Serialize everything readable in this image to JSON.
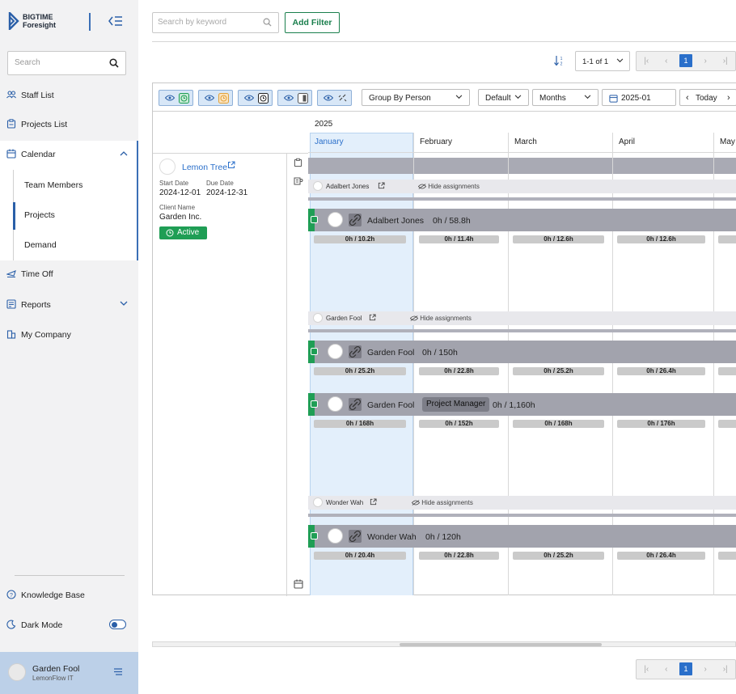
{
  "brand": {
    "line1": "BIGTIME",
    "line2": "Foresight"
  },
  "sidebar": {
    "search_placeholder": "Search",
    "items": [
      {
        "label": "Staff List",
        "icon": "users-icon"
      },
      {
        "label": "Projects List",
        "icon": "clipboard-icon"
      },
      {
        "label": "Calendar",
        "icon": "calendar-icon"
      },
      {
        "label": "Time Off",
        "icon": "airplane-icon"
      },
      {
        "label": "Reports",
        "icon": "report-icon"
      },
      {
        "label": "My Company",
        "icon": "building-icon"
      }
    ],
    "calendar_sub": [
      "Team Members",
      "Projects",
      "Demand"
    ],
    "knowledge_base": "Knowledge Base",
    "dark_mode": "Dark Mode",
    "user": {
      "name": "Garden Fool",
      "company": "LemonFlow IT"
    }
  },
  "toolbar": {
    "search_placeholder": "Search by keyword",
    "add_filter": "Add Filter",
    "page_range": "1-1 of 1",
    "current_page": "1"
  },
  "calendar": {
    "group_by": "Group By Person",
    "sort": "Default",
    "scale": "Months",
    "date": "2025-01",
    "today": "Today",
    "year": "2025",
    "months": [
      "January",
      "February",
      "March",
      "April",
      "May"
    ],
    "hide_label": "Hide assignments"
  },
  "project": {
    "name": "Lemon Tree",
    "start_label": "Start Date",
    "start": "2024-12-01",
    "due_label": "Due Date",
    "due": "2024-12-31",
    "client_label": "Client Name",
    "client": "Garden Inc.",
    "status": "Active"
  },
  "people": [
    {
      "name": "Adalbert Jones"
    },
    {
      "name": "Garden Fool"
    },
    {
      "name": "Wonder Wah"
    }
  ],
  "assignments": [
    {
      "name": "Adalbert Jones",
      "total": "0h / 58.8h",
      "role": "",
      "hours": [
        "0h / 10.2h",
        "0h / 11.4h",
        "0h / 12.6h",
        "0h / 12.6h",
        ""
      ]
    },
    {
      "name": "Garden Fool",
      "total": "0h / 150h",
      "role": "",
      "hours": [
        "0h / 25.2h",
        "0h / 22.8h",
        "0h / 25.2h",
        "0h / 26.4h",
        ""
      ]
    },
    {
      "name": "Garden Fool",
      "total": "0h / 1,160h",
      "role": "Project Manager",
      "hours": [
        "0h / 168h",
        "0h / 152h",
        "0h / 168h",
        "0h / 176h",
        ""
      ]
    },
    {
      "name": "Wonder Wah",
      "total": "0h / 120h",
      "role": "",
      "hours": [
        "0h / 20.4h",
        "0h / 22.8h",
        "0h / 25.2h",
        "0h / 26.4h",
        ""
      ]
    }
  ],
  "colors": {
    "brand_blue": "#2a5fa8",
    "active_green": "#1f9e55",
    "filter_green": "#1a7f4d"
  }
}
